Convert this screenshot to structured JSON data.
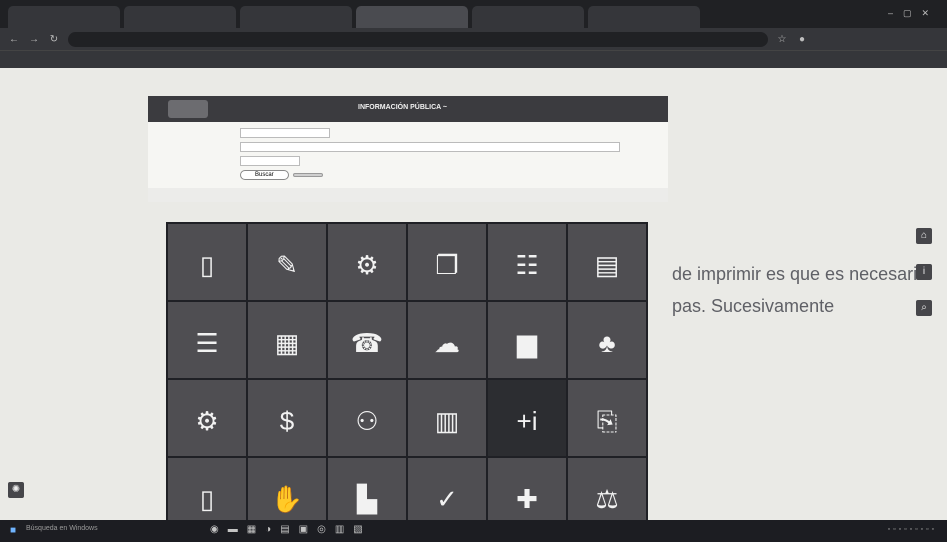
{
  "browser": {
    "tabs": [
      "",
      "",
      "",
      "",
      "",
      ""
    ],
    "url": ""
  },
  "bookmarks": [
    "",
    "",
    "",
    "",
    "",
    "",
    ""
  ],
  "portal": {
    "header_title": "INFORMACIÓN PÚBLICA ~",
    "filters": [
      {
        "label": "",
        "value": ""
      },
      {
        "label": "",
        "value": ""
      },
      {
        "label": "",
        "value": ""
      }
    ],
    "search_label": "Buscar",
    "clear_label": "",
    "info_text": ""
  },
  "ghost_text": {
    "line1": "de imprimir es que es necesario",
    "line2": "pas. Sucesivamente"
  },
  "tiles": [
    {
      "label": "",
      "icon": "tablet-icon",
      "glyph": "▯"
    },
    {
      "label": "",
      "icon": "document-edit-icon",
      "glyph": "✎"
    },
    {
      "label": "",
      "icon": "gears-icon",
      "glyph": "⚙"
    },
    {
      "label": "",
      "icon": "file-stack-icon",
      "glyph": "❐"
    },
    {
      "label": "",
      "icon": "document-person-icon",
      "glyph": "☷"
    },
    {
      "label": "",
      "icon": "clipboard-user-icon",
      "glyph": "▤"
    },
    {
      "label": "",
      "icon": "document-list-icon",
      "glyph": "☰"
    },
    {
      "label": "",
      "icon": "presentation-chart-icon",
      "glyph": "▦"
    },
    {
      "label": "",
      "icon": "contacts-book-icon",
      "glyph": "☎"
    },
    {
      "label": "",
      "icon": "folder-cloud-icon",
      "glyph": "☁"
    },
    {
      "label": "",
      "icon": "bar-chart-icon",
      "glyph": "▆"
    },
    {
      "label": "",
      "icon": "org-chart-icon",
      "glyph": "♣"
    },
    {
      "label": "",
      "icon": "gear-settings-icon",
      "glyph": "⚙"
    },
    {
      "label": "",
      "icon": "money-case-icon",
      "glyph": "$"
    },
    {
      "label": "",
      "icon": "people-growth-icon",
      "glyph": "⚇"
    },
    {
      "label": "",
      "icon": "chart-check-icon",
      "glyph": "▥"
    },
    {
      "label": "",
      "icon": "plus-info-icon",
      "glyph": "+i"
    },
    {
      "label": "",
      "icon": "document-gear-icon",
      "glyph": "⎘"
    },
    {
      "label": "",
      "icon": "document-icon",
      "glyph": "▯"
    },
    {
      "label": "",
      "icon": "hand-money-icon",
      "glyph": "✋"
    },
    {
      "label": "",
      "icon": "building-chart-icon",
      "glyph": "▙"
    },
    {
      "label": "",
      "icon": "document-check-icon",
      "glyph": "✓"
    },
    {
      "label": "",
      "icon": "puzzle-icon",
      "glyph": "✚"
    },
    {
      "label": "",
      "icon": "gavel-icon",
      "glyph": "⚖"
    }
  ],
  "side_buttons": [
    {
      "icon": "home-icon",
      "glyph": "⌂"
    },
    {
      "icon": "info-icon",
      "glyph": "i"
    },
    {
      "icon": "search-icon",
      "glyph": "⌕"
    }
  ],
  "taskbar": {
    "search_placeholder": "Búsqueda en Windows"
  },
  "colors": {
    "tile": "#4f4e52",
    "tile_dark": "#2c2d31",
    "grid_bg": "#1f2025",
    "header": "#3b3b3f"
  }
}
